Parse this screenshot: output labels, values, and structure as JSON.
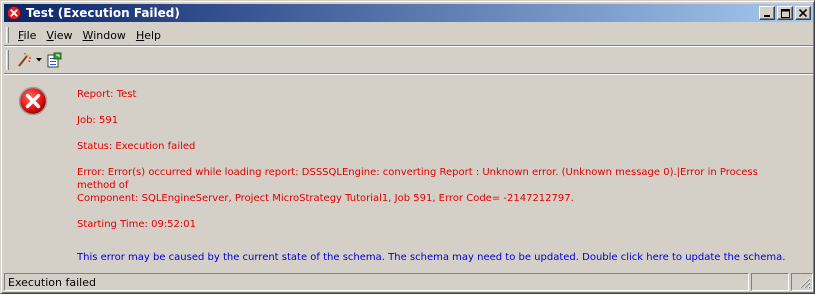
{
  "window": {
    "title": "Test (Execution Failed)",
    "title_icon": "error-x-icon",
    "controls": [
      "minimize-icon",
      "maximize-icon",
      "close-icon"
    ]
  },
  "menu": {
    "items": [
      {
        "label": "File",
        "accel": "F"
      },
      {
        "label": "View",
        "accel": "V"
      },
      {
        "label": "Window",
        "accel": "W"
      },
      {
        "label": "Help",
        "accel": "H"
      }
    ]
  },
  "toolbar": {
    "buttons": [
      "magic-wand-icon",
      "report-refresh-icon"
    ]
  },
  "content": {
    "icon": "error-icon",
    "report": "Report: Test",
    "job": "Job: 591",
    "status": "Status: Execution failed",
    "error_line1": "Error: Error(s) occurred while loading report: DSSSQLEngine: converting Report : Unknown error. (Unknown message 0).|Error in Process method of",
    "error_line2": "Component: SQLEngineServer, Project MicroStrategy Tutorial1, Job 591, Error Code= -2147212797.",
    "starting_time": "Starting Time: 09:52:01",
    "schema_message": "This error may be caused by the current state of the schema. The schema may need to be updated. Double click here to update the schema."
  },
  "statusbar": {
    "text": "Execution failed",
    "pane2": "",
    "pane3": ""
  },
  "colors": {
    "error_text": "#e00000",
    "link_text": "#0000d0",
    "title_start": "#0a246a",
    "title_end": "#a6caf0",
    "face": "#d4d0c8"
  }
}
